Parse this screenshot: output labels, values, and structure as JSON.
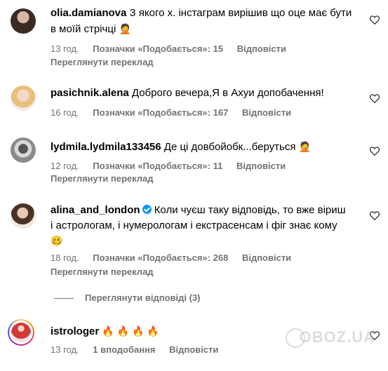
{
  "comments": [
    {
      "username": "olia.damianova",
      "text": "З якого х. інстаграм вирішив що оце має бути в моїй стрічці",
      "emoji": "🤦",
      "time": "13 год.",
      "likes": "Позначки «Подобається»: 15",
      "reply": "Відповісти",
      "translate": "Переглянути переклад"
    },
    {
      "username": "pasichnik.alena",
      "text": "Доброго вечера,Я в Ахуи допобачення!",
      "emoji": "",
      "time": "16 год.",
      "likes": "Позначки «Подобається»: 167",
      "reply": "Відповісти",
      "translate": ""
    },
    {
      "username": "lydmila.lydmila133456",
      "text": "Де ці довбойобк...беруться",
      "emoji": "🤦",
      "time": "12 год.",
      "likes": "Позначки «Подобається»: 11",
      "reply": "Відповісти",
      "translate": "Переглянути переклад"
    },
    {
      "username": "alina_and_london",
      "text_line1": "Коли чуєш таку відповідь, то вже віриш",
      "text_line2": "і астрологам, і нумерологам і екстрасенсам і фіг знає кому",
      "emoji": "🥴",
      "time": "18 год.",
      "likes": "Позначки «Подобається»: 268",
      "reply": "Відповісти",
      "translate": "Переглянути переклад"
    },
    {
      "username": "istrologer",
      "emoji": "🔥 🔥 🔥 🔥",
      "time": "13 год.",
      "likes": "1 вподобання",
      "reply": "Відповісти"
    }
  ],
  "view_replies": "Переглянути відповіді (3)",
  "watermark": "OBOZ.UA",
  "colors": {
    "meta": "#737373",
    "verified": "#0095f6"
  }
}
